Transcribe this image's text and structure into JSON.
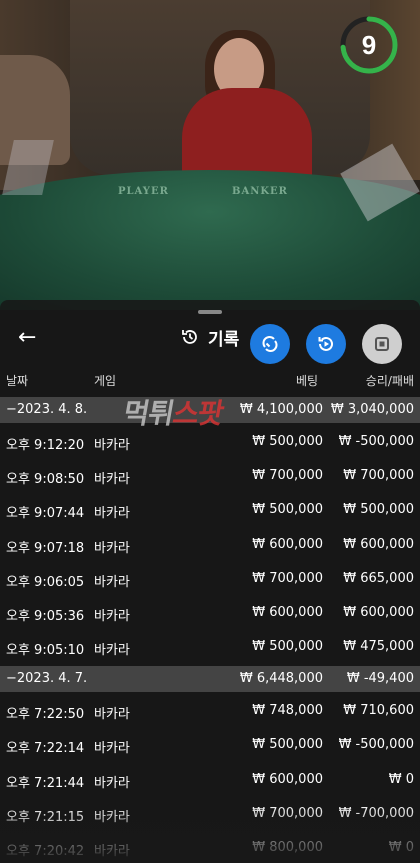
{
  "video": {
    "timer": "9",
    "table_labels": [
      "PLAYER",
      "BANKER"
    ]
  },
  "panel": {
    "title": "기록",
    "headers": {
      "date": "날짜",
      "game": "게임",
      "bet": "베팅",
      "result": "승리/패배"
    },
    "watermark": {
      "a": "먹튀",
      "b": "스팟"
    },
    "icons": [
      "back-arrow-icon",
      "history-icon",
      "swap-icon",
      "replay-icon",
      "stop-icon"
    ],
    "colors": {
      "accent_blue": "#1e7be0",
      "timer_green": "#35b34a",
      "date_row": "#444444"
    },
    "rows": [
      {
        "type": "date",
        "time": "−2023. 4. 8.",
        "game": "",
        "bet": "₩ 4,100,000",
        "result": "₩ 3,040,000"
      },
      {
        "type": "entry",
        "time": "오후 9:12:20",
        "game": "바카라",
        "bet": "₩ 500,000",
        "result": "₩ -500,000"
      },
      {
        "type": "entry",
        "time": "오후 9:08:50",
        "game": "바카라",
        "bet": "₩ 700,000",
        "result": "₩ 700,000"
      },
      {
        "type": "entry",
        "time": "오후 9:07:44",
        "game": "바카라",
        "bet": "₩ 500,000",
        "result": "₩ 500,000"
      },
      {
        "type": "entry",
        "time": "오후 9:07:18",
        "game": "바카라",
        "bet": "₩ 600,000",
        "result": "₩ 600,000"
      },
      {
        "type": "entry",
        "time": "오후 9:06:05",
        "game": "바카라",
        "bet": "₩ 700,000",
        "result": "₩ 665,000"
      },
      {
        "type": "entry",
        "time": "오후 9:05:36",
        "game": "바카라",
        "bet": "₩ 600,000",
        "result": "₩ 600,000"
      },
      {
        "type": "entry",
        "time": "오후 9:05:10",
        "game": "바카라",
        "bet": "₩ 500,000",
        "result": "₩ 475,000"
      },
      {
        "type": "date",
        "time": "−2023. 4. 7.",
        "game": "",
        "bet": "₩ 6,448,000",
        "result": "₩ -49,400"
      },
      {
        "type": "entry",
        "time": "오후 7:22:50",
        "game": "바카라",
        "bet": "₩ 748,000",
        "result": "₩ 710,600"
      },
      {
        "type": "entry",
        "time": "오후 7:22:14",
        "game": "바카라",
        "bet": "₩ 500,000",
        "result": "₩ -500,000"
      },
      {
        "type": "entry",
        "time": "오후 7:21:44",
        "game": "바카라",
        "bet": "₩ 600,000",
        "result": "₩ 0"
      },
      {
        "type": "entry",
        "time": "오후 7:21:15",
        "game": "바카라",
        "bet": "₩ 700,000",
        "result": "₩ -700,000"
      },
      {
        "type": "entry",
        "time": "오후 7:20:42",
        "game": "바카라",
        "bet": "₩ 800,000",
        "result": "₩ 0"
      }
    ]
  }
}
